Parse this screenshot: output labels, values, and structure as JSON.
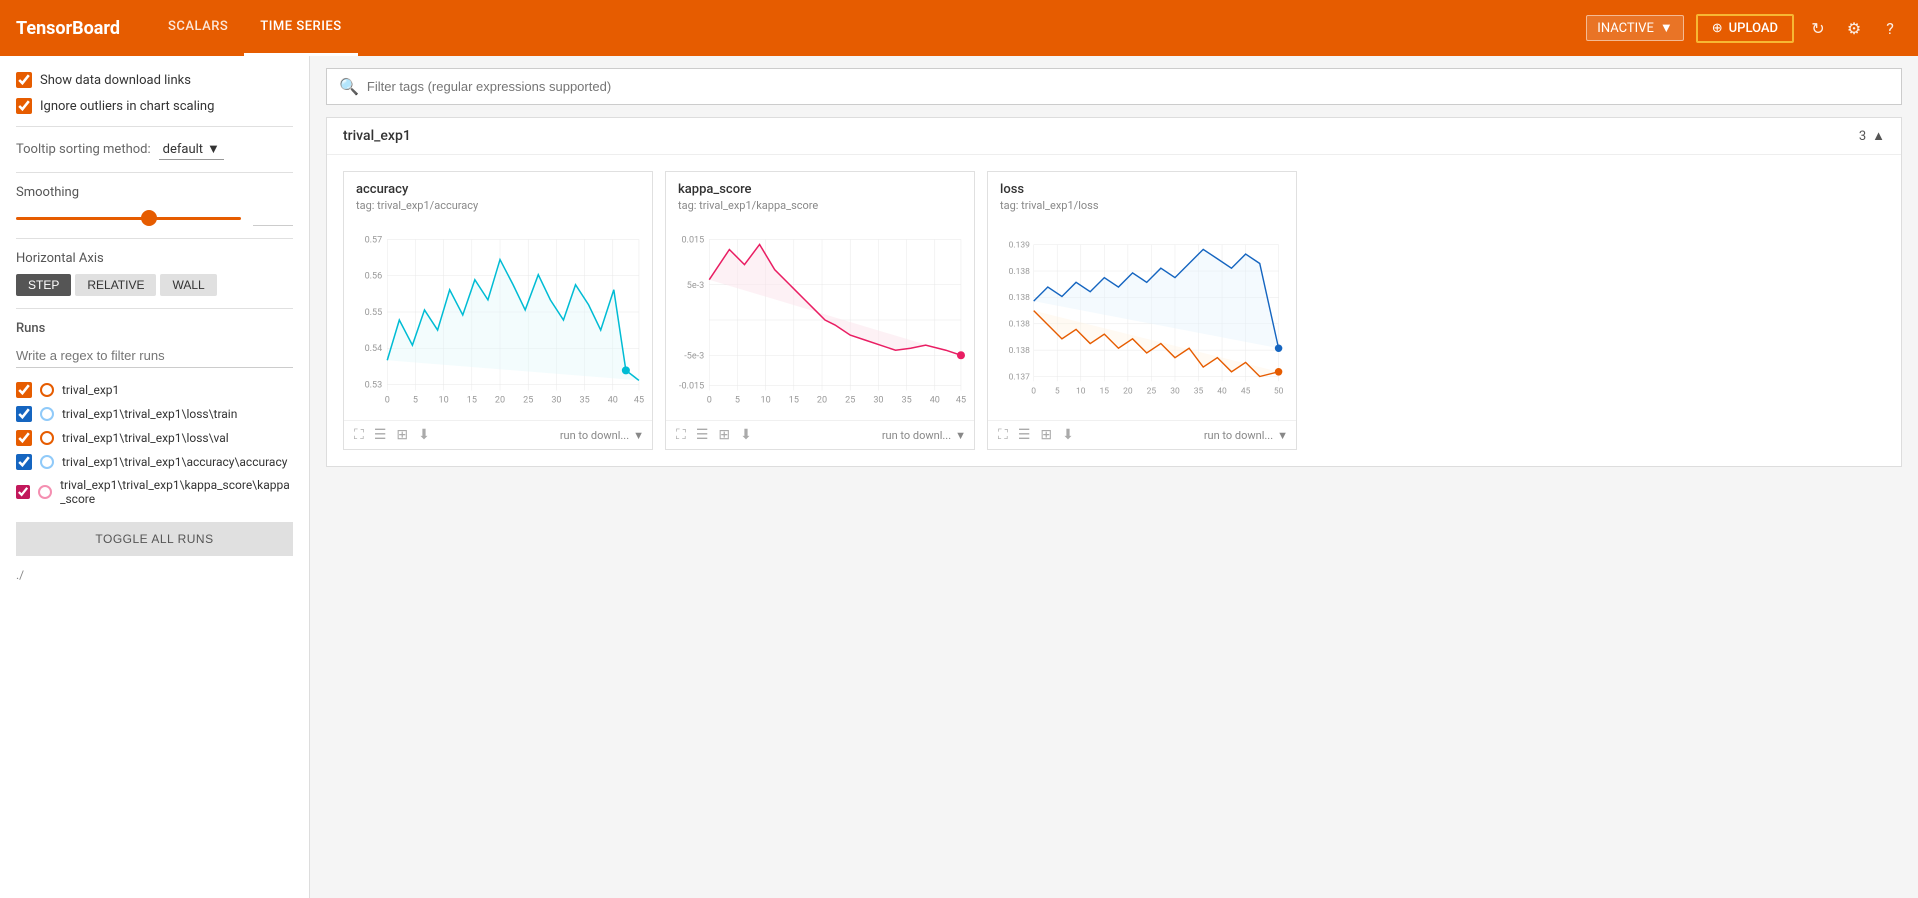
{
  "app": {
    "logo": "TensorBoard",
    "nav": [
      {
        "label": "SCALARS",
        "active": false
      },
      {
        "label": "TIME SERIES",
        "active": true
      }
    ],
    "inactive_label": "INACTIVE",
    "upload_label": "UPLOAD"
  },
  "sidebar": {
    "show_download_links": true,
    "ignore_outliers": true,
    "show_download_label": "Show data download links",
    "ignore_outliers_label": "Ignore outliers in chart scaling",
    "tooltip_label": "Tooltip sorting method:",
    "tooltip_value": "default",
    "smoothing_label": "Smoothing",
    "smoothing_value": "0.6",
    "h_axis_label": "Horizontal Axis",
    "axis_buttons": [
      {
        "label": "STEP",
        "active": true
      },
      {
        "label": "RELATIVE",
        "active": false
      },
      {
        "label": "WALL",
        "active": false
      }
    ],
    "runs_label": "Runs",
    "runs_filter_placeholder": "Write a regex to filter runs",
    "runs": [
      {
        "name": "trival_exp1",
        "color": "#e65c00",
        "circle_color": "#e65c00",
        "checked": true
      },
      {
        "name": "trival_exp1\\trival_exp1\\loss\\train",
        "color": "#1565c0",
        "circle_color": "#90caf9",
        "checked": true
      },
      {
        "name": "trival_exp1\\trival_exp1\\loss\\val",
        "color": "#e65c00",
        "circle_color": "#e65c00",
        "checked": true
      },
      {
        "name": "trival_exp1\\trival_exp1\\accuracy\\accuracy",
        "color": "#1565c0",
        "circle_color": "#90caf9",
        "checked": true
      },
      {
        "name": "trival_exp1\\trival_exp1\\kappa_score\\kappa_score",
        "color": "#c2185b",
        "circle_color": "#f48fb1",
        "checked": true
      }
    ],
    "toggle_all_label": "TOGGLE ALL RUNS",
    "current_dir": "./"
  },
  "filter": {
    "placeholder": "Filter tags (regular expressions supported)"
  },
  "section": {
    "title": "trival_exp1",
    "count": "3"
  },
  "charts": [
    {
      "title": "accuracy",
      "tag": "tag: trival_exp1/accuracy",
      "color": "#00bcd4",
      "y_labels": [
        "0.57",
        "0.56",
        "0.55",
        "0.54",
        "0.53"
      ],
      "x_labels": [
        "0",
        "5",
        "10",
        "15",
        "20",
        "25",
        "30",
        "35",
        "40",
        "45"
      ],
      "download_label": "run to downl..."
    },
    {
      "title": "kappa_score",
      "tag": "tag: trival_exp1/kappa_score",
      "color": "#e91e8c",
      "y_labels": [
        "0.015",
        "5e-3",
        "-5e-3",
        "-0.015"
      ],
      "x_labels": [
        "0",
        "5",
        "10",
        "15",
        "20",
        "25",
        "30",
        "35",
        "40",
        "45"
      ],
      "download_label": "run to downl..."
    },
    {
      "title": "loss",
      "tag": "tag: trival_exp1/loss",
      "color_1": "#1565c0",
      "color_2": "#e65c00",
      "y_labels": [
        "0.139",
        "0.138",
        "0.138",
        "0.138",
        "0.138",
        "0.137"
      ],
      "x_labels": [
        "0",
        "5",
        "10",
        "15",
        "20",
        "25",
        "30",
        "35",
        "40",
        "45",
        "50"
      ],
      "download_label": "run to downl..."
    }
  ],
  "icons": {
    "search": "🔍",
    "expand": "⛶",
    "menu": "☰",
    "zoom": "⊞",
    "download": "⬇",
    "chevron_up": "▲",
    "chevron_down": "▼",
    "refresh": "↻",
    "gear": "⚙",
    "help": "?"
  }
}
